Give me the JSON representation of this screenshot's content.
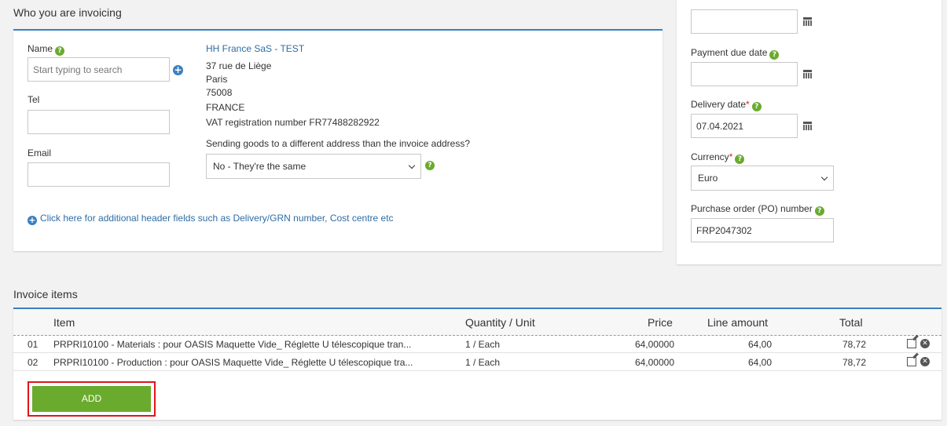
{
  "who": {
    "heading": "Who you are invoicing",
    "name_label": "Name",
    "name_placeholder": "Start typing to search",
    "tel_label": "Tel",
    "tel_value": "",
    "email_label": "Email",
    "email_value": "",
    "address": {
      "company": "HH France SaS - TEST",
      "street": "37 rue de Liège",
      "city": "Paris",
      "postcode": "75008",
      "country": "FRANCE",
      "vat": "VAT registration number FR77488282922"
    },
    "different_address_question": "Sending goods to a different address than the invoice address?",
    "different_address_value": "No - They're the same",
    "additional_fields_link": "Click here for additional header fields such as Delivery/GRN number, Cost centre etc"
  },
  "side": {
    "top_date_value": "",
    "payment_due_label": "Payment due date",
    "payment_due_value": "",
    "delivery_label": "Delivery date",
    "delivery_required": "*",
    "delivery_value": "07.04.2021",
    "currency_label": "Currency",
    "currency_required": "*",
    "currency_value": "Euro",
    "po_label": "Purchase order (PO) number",
    "po_value": "FRP2047302"
  },
  "items": {
    "heading": "Invoice items",
    "columns": {
      "item": "Item",
      "qty": "Quantity / Unit",
      "price": "Price",
      "line": "Line amount",
      "total": "Total"
    },
    "rows": [
      {
        "num": "01",
        "item": "PRPRI10100 - Materials : pour OASIS Maquette Vide_ Réglette U télescopique tran...",
        "qty": "1 / Each",
        "price": "64,00000",
        "line": "64,00",
        "total": "78,72"
      },
      {
        "num": "02",
        "item": "PRPRI10100 - Production : pour OASIS Maquette Vide_ Réglette U télescopique tra...",
        "qty": "1 / Each",
        "price": "64,00000",
        "line": "64,00",
        "total": "78,72"
      }
    ],
    "add_label": "ADD"
  },
  "icons": {
    "help": "help-icon",
    "calendar": "calendar-icon",
    "plus": "plus-circle-icon",
    "edit": "edit-icon",
    "delete": "delete-icon"
  },
  "colors": {
    "accent_blue": "#3a7fc0",
    "link_blue": "#2e6da4",
    "help_green": "#6aab2e",
    "add_green": "#6aab2e",
    "required_red": "#d9232d",
    "highlight_red": "#e0141b"
  }
}
